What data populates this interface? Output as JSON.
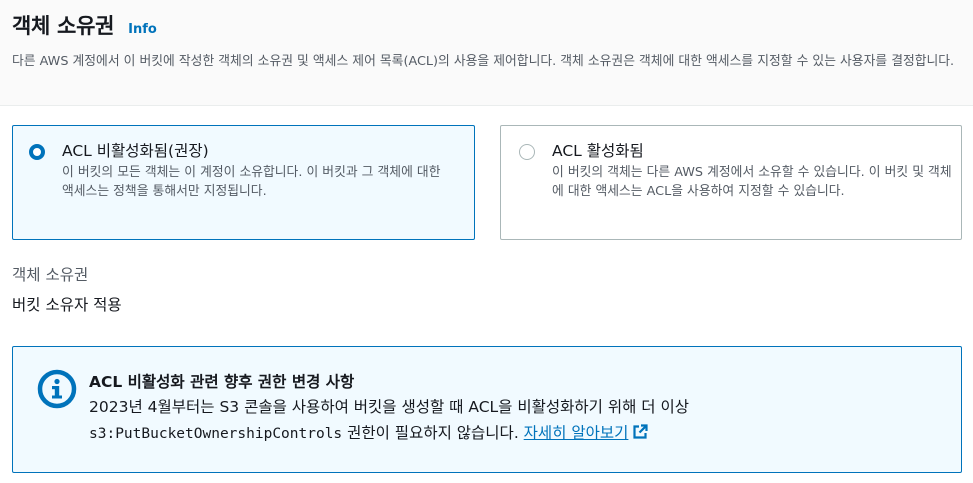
{
  "header": {
    "title": "객체 소유권",
    "info_label": "Info",
    "description": "다른 AWS 계정에서 이 버킷에 작성한 객체의 소유권 및 액세스 제어 목록(ACL)의 사용을 제어합니다. 객체 소유권은 객체에 대한 액세스를 지정할 수 있는 사용자를 결정합니다."
  },
  "options": [
    {
      "label": "ACL 비활성화됨(권장)",
      "description": "이 버킷의 모든 객체는 이 계정이 소유합니다. 이 버킷과 그 객체에 대한 액세스는 정책을 통해서만 지정됩니다.",
      "selected": true
    },
    {
      "label": "ACL 활성화됨",
      "description": "이 버킷의 객체는 다른 AWS 계정에서 소유할 수 있습니다. 이 버킷 및 객체에 대한 액세스는 ACL을 사용하여 지정할 수 있습니다.",
      "selected": false
    }
  ],
  "ownership": {
    "label": "객체 소유권",
    "value": "버킷 소유자 적용"
  },
  "alert": {
    "icon": "info-icon",
    "title": "ACL 비활성화 관련 향후 권한 변경 사항",
    "line1": "2023년 4월부터는 S3 콘솔을 사용하여 버킷을 생성할 때 ACL을 비활성화하기 위해 더 이상",
    "code": "s3:PutBucketOwnershipControls",
    "line2_rest": " 권한이 필요하지 않습니다. ",
    "learn_more": "자세히 알아보기",
    "external_icon": "external-link-icon"
  },
  "colors": {
    "accent": "#0073bb",
    "selected_bg": "#f1faff",
    "text": "#16191f",
    "secondary_text": "#545b64",
    "border": "#aab7b8"
  }
}
